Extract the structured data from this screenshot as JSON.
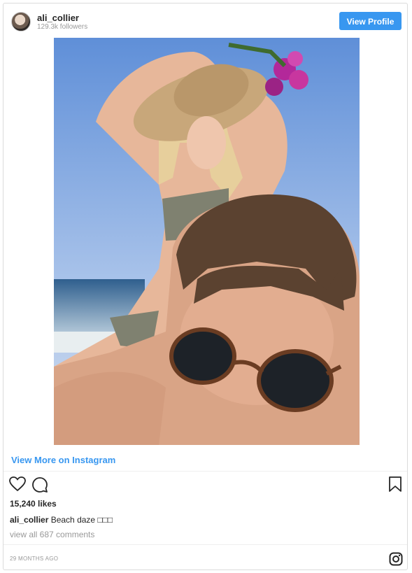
{
  "header": {
    "username": "ali_collier",
    "followers": "129.3k followers",
    "view_profile_label": "View Profile"
  },
  "post": {
    "view_more_label": "View More on Instagram",
    "likes": "15,240 likes",
    "caption_user": "ali_collier",
    "caption_text": " Beach daze □□□",
    "comments_link": "view all 687 comments",
    "timestamp": "29 MONTHS AGO"
  },
  "icons": {
    "like": "heart-icon",
    "comment": "comment-icon",
    "save": "bookmark-icon",
    "brand": "instagram-icon"
  },
  "colors": {
    "accent": "#3897f0",
    "text": "#262626",
    "muted": "#999999"
  }
}
